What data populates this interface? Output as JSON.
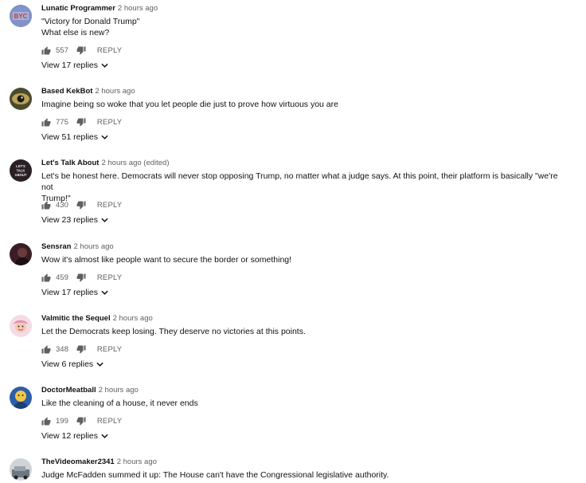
{
  "comments": [
    {
      "author": "Lunatic Programmer",
      "time": "2 hours ago",
      "text_lines": [
        "\"Victory for Donald Trump\"",
        "What else is new?"
      ],
      "likes": "557",
      "reply": "REPLY",
      "view_replies": "View 17 replies",
      "avatar_text": "BYC"
    },
    {
      "author": "Based KekBot",
      "time": "2 hours ago",
      "text_lines": [
        "Imagine being so woke that you let people die just to prove how virtuous you are"
      ],
      "likes": "775",
      "reply": "REPLY",
      "view_replies": "View 51 replies"
    },
    {
      "author": "Let's Talk About",
      "time": "2 hours ago (edited)",
      "text_lines": [
        "Let's be honest here. Democrats will never stop opposing Trump, no matter what a judge says. At this point, their platform is  basically \"we're not",
        "Trump!\""
      ],
      "likes": "430",
      "reply": "REPLY",
      "view_replies": "View 23 replies",
      "avatar_text": "LET'S TALK ABOUT"
    },
    {
      "author": "Sensran",
      "time": "2 hours ago",
      "text_lines": [
        "Wow it's almost like people want to secure the border or something!"
      ],
      "likes": "459",
      "reply": "REPLY",
      "view_replies": "View 17 replies"
    },
    {
      "author": "Valmitic the Sequel",
      "time": "2 hours ago",
      "text_lines": [
        "Let the Democrats keep losing. They deserve no victories at this points."
      ],
      "likes": "348",
      "reply": "REPLY",
      "view_replies": "View 6 replies"
    },
    {
      "author": "DoctorMeatball",
      "time": "2 hours ago",
      "text_lines": [
        "Like the cleaning of a house, it never ends"
      ],
      "likes": "199",
      "reply": "REPLY",
      "view_replies": "View 12 replies"
    },
    {
      "author": "TheVideomaker2341",
      "time": "2 hours ago",
      "text_lines": [
        "Judge McFadden summed it up: The House can't have the Congressional legislative authority."
      ]
    }
  ],
  "icons": {
    "like": "thumbs-up-icon",
    "dislike": "thumbs-down-icon",
    "chevron": "chevron-down-icon"
  },
  "colors": {
    "meta": "#606060",
    "text": "#111111"
  }
}
